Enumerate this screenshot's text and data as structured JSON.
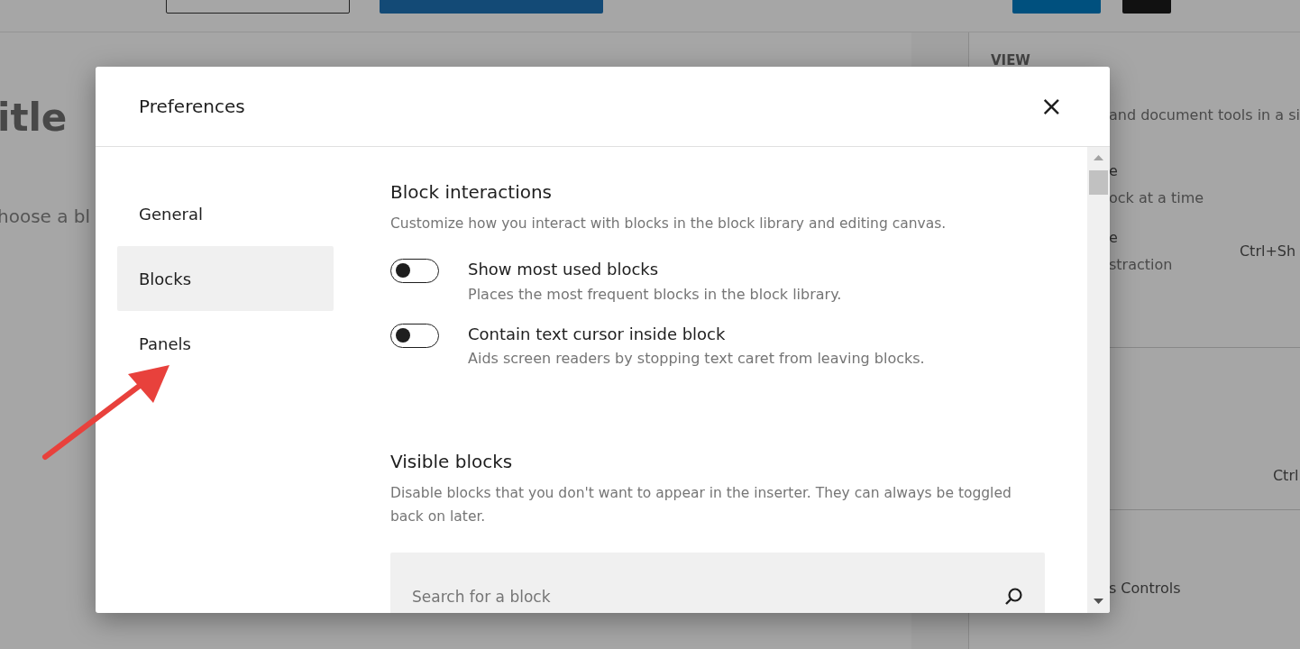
{
  "background": {
    "title_fragment": "itle",
    "prompt_fragment": "hoose a bl",
    "sidebar": {
      "heading": "VIEW",
      "sections": [
        {
          "items": [
            {
              "description": "and document tools in a si"
            },
            {
              "label": "e",
              "description": "ock at a time"
            },
            {
              "label": "e",
              "description": "straction",
              "shortcut": "Ctrl+Sh"
            }
          ]
        },
        {
          "items": [
            {
              "shortcut": "Ctrl"
            }
          ]
        },
        {
          "items": [
            {
              "label": "s Controls"
            }
          ]
        }
      ]
    }
  },
  "dialog": {
    "title": "Preferences",
    "close": "×",
    "tabs": [
      {
        "label": "General",
        "selected": false
      },
      {
        "label": "Blocks",
        "selected": true
      },
      {
        "label": "Panels",
        "selected": false
      }
    ],
    "sections": [
      {
        "title": "Block interactions",
        "description": "Customize how you interact with blocks in the block library and editing canvas.",
        "toggles": [
          {
            "label": "Show most used blocks",
            "help": "Places the most frequent blocks in the block library.",
            "checked": false
          },
          {
            "label": "Contain text cursor inside block",
            "help": "Aids screen readers by stopping text caret from leaving blocks.",
            "checked": false
          }
        ]
      },
      {
        "title": "Visible blocks",
        "description": "Disable blocks that you don't want to appear in the inserter. They can always be toggled back on later.",
        "search": {
          "placeholder": "Search for a block"
        }
      }
    ]
  }
}
